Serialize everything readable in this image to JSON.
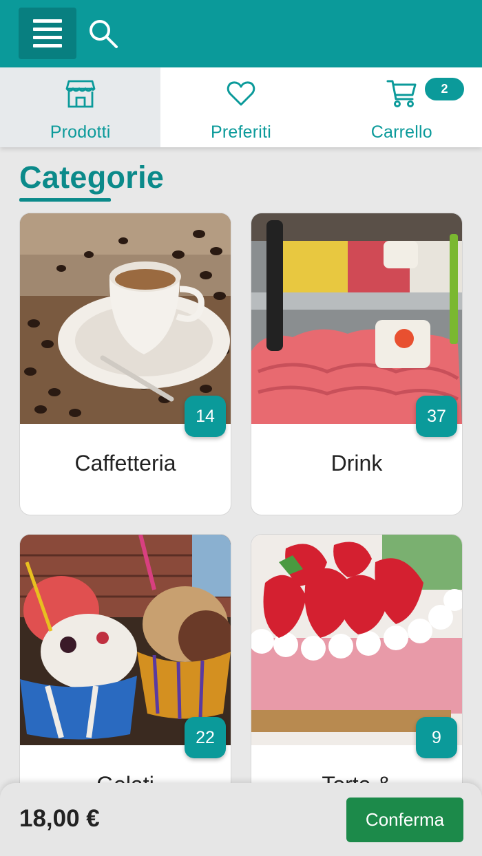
{
  "header": {
    "menu_icon": "hamburger-menu-icon",
    "search_icon": "search-icon",
    "color": "#0b9a9a"
  },
  "nav": {
    "tabs": [
      {
        "label": "Prodotti",
        "icon": "store-icon",
        "active": true
      },
      {
        "label": "Preferiti",
        "icon": "heart-icon",
        "active": false
      },
      {
        "label": "Carrello",
        "icon": "cart-icon",
        "active": false,
        "badge": "2"
      }
    ]
  },
  "section": {
    "title": "Categorie"
  },
  "categories": [
    {
      "name": "Caffetteria",
      "count": "14",
      "image": "coffee-cup-image"
    },
    {
      "name": "Drink",
      "count": "37",
      "image": "strawberry-gelato-image"
    },
    {
      "name": "Gelati",
      "count": "22",
      "image": "gelato-cups-image"
    },
    {
      "name": "Torte &",
      "count": "9",
      "image": "strawberry-cake-image"
    }
  ],
  "footer": {
    "total": "18,00 €",
    "confirm_label": "Conferma",
    "confirm_color": "#1c8a4a"
  }
}
